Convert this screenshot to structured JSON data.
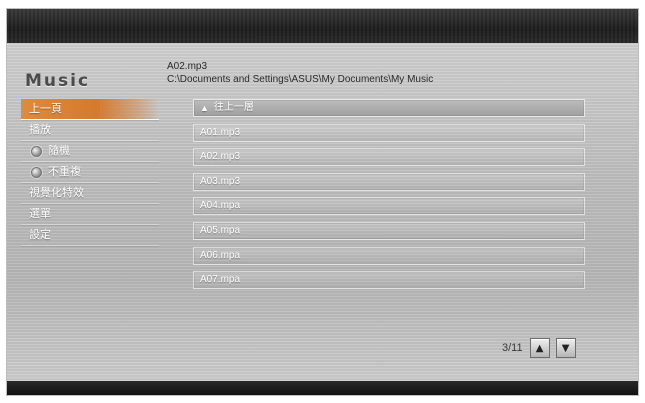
{
  "app": {
    "title": "Music"
  },
  "now_playing": {
    "file": "A02.mp3",
    "path": "C:\\Documents and Settings\\ASUS\\My Documents\\My Music"
  },
  "menu": {
    "items": [
      {
        "label": "上一頁",
        "active": true
      },
      {
        "label": "播放"
      },
      {
        "label": "隨機",
        "radio": true
      },
      {
        "label": "不重複",
        "radio": true
      },
      {
        "label": "視覺化特效"
      },
      {
        "label": "選單"
      },
      {
        "label": "設定"
      }
    ]
  },
  "file_list": {
    "up_label": "往上一層",
    "files": [
      "A01.mp3",
      "A02.mp3",
      "A03.mp3",
      "A04.mpa",
      "A05.mpa",
      "A06.mpa",
      "A07.mpa"
    ]
  },
  "pager": {
    "indicator": "3/11",
    "up_icon": "triangle-up-icon",
    "down_icon": "triangle-down-icon"
  },
  "colors": {
    "accent": "#d97f30",
    "panel": "#c3c3c3",
    "frame": "#1c1c1c"
  }
}
